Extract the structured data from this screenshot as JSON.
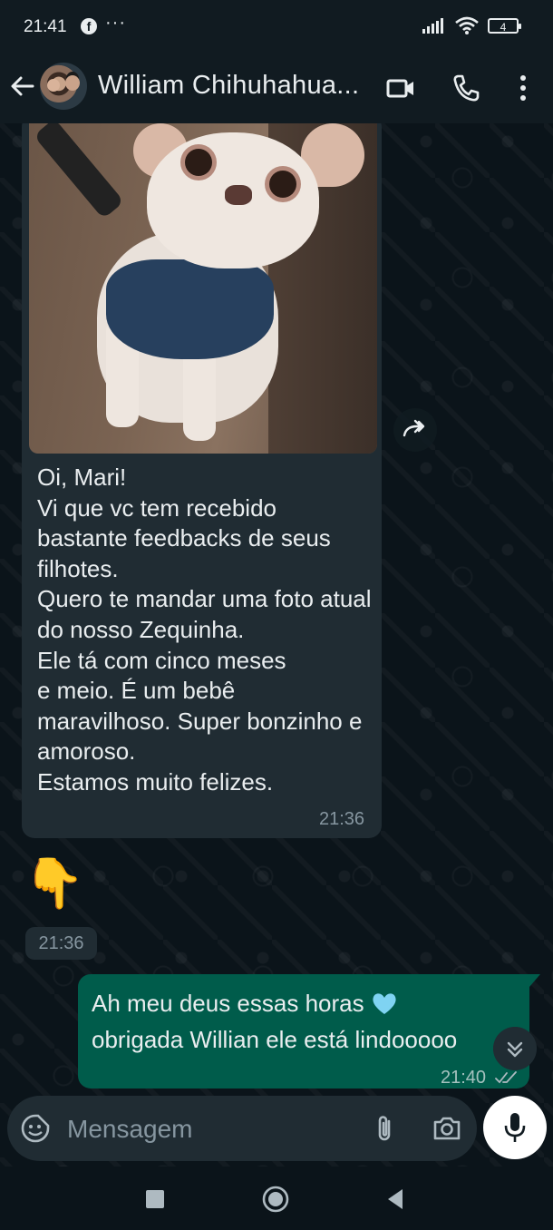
{
  "status_bar": {
    "time": "21:41",
    "facebook_glyph": "f",
    "more_dots": "···",
    "battery_level": "4"
  },
  "header": {
    "contact_name": "William Chihuhahua..."
  },
  "messages": {
    "incoming": {
      "text": "Oi, Mari!\nVi que vc tem recebido bastante feedbacks de seus filhotes.\nQuero te mandar uma foto atual do nosso Zequinha.\nEle tá com cinco meses\ne meio.  É um bebê maravilhoso. Super bonzinho e amoroso.\nEstamos muito felizes.",
      "time": "21:36"
    },
    "incoming_emoji": {
      "emoji": "👇",
      "time": "21:36"
    },
    "outgoing": {
      "line1": "Ah meu deus essas horas",
      "line2": "obrigada Willian ele está lindooooo",
      "time": "21:40"
    }
  },
  "composer": {
    "placeholder": "Mensagem"
  },
  "colors": {
    "header_bg": "#111b21",
    "incoming_bubble": "#202c33",
    "outgoing_bubble": "#005c4b",
    "chat_bg": "#0b141a"
  }
}
